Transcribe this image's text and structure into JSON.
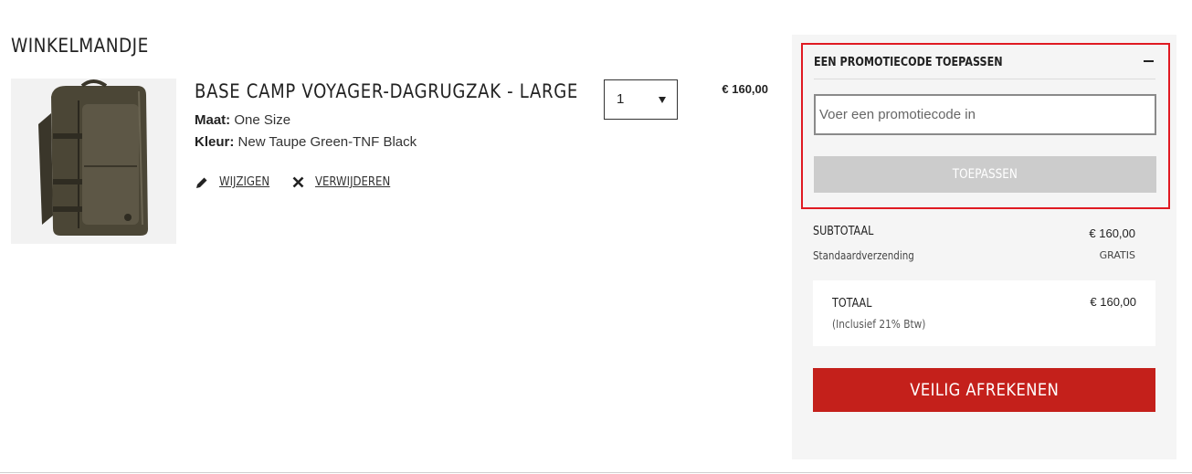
{
  "cart": {
    "title": "WINKELMANDJE"
  },
  "item": {
    "name": "BASE CAMP VOYAGER-DAGRUGZAK - LARGE",
    "size_label": "Maat:",
    "size_value": "One Size",
    "color_label": "Kleur:",
    "color_value": "New Taupe Green-TNF Black",
    "edit_label": "WIJZIGEN",
    "remove_label": "VERWIJDEREN",
    "quantity": "1",
    "price": "€ 160,00",
    "image_icon": "backpack-image",
    "colors": {
      "bag": "#4b4636",
      "bag_dark": "#3a362a",
      "bag_light": "#5d5746"
    }
  },
  "promo": {
    "title": "EEN PROMOTIECODE TOEPASSEN",
    "placeholder": "Voer een promotiecode in",
    "value": "",
    "apply_label": "TOEPASSEN",
    "collapse_icon": "minus-icon"
  },
  "summary": {
    "subtotal_label": "SUBTOTAAL",
    "subtotal_value": "€ 160,00",
    "shipping_label": "Standaardverzending",
    "shipping_value": "GRATIS",
    "total_label": "TOTAAL",
    "total_value": "€ 160,00",
    "vat_note": "(Inclusief 21% Btw)",
    "checkout_label": "VEILIG AFREKENEN"
  },
  "colors": {
    "accent_red": "#c4201b",
    "highlight_border": "#e01a22",
    "panel_bg": "#f5f5f5",
    "disabled_button": "#cccccc"
  }
}
